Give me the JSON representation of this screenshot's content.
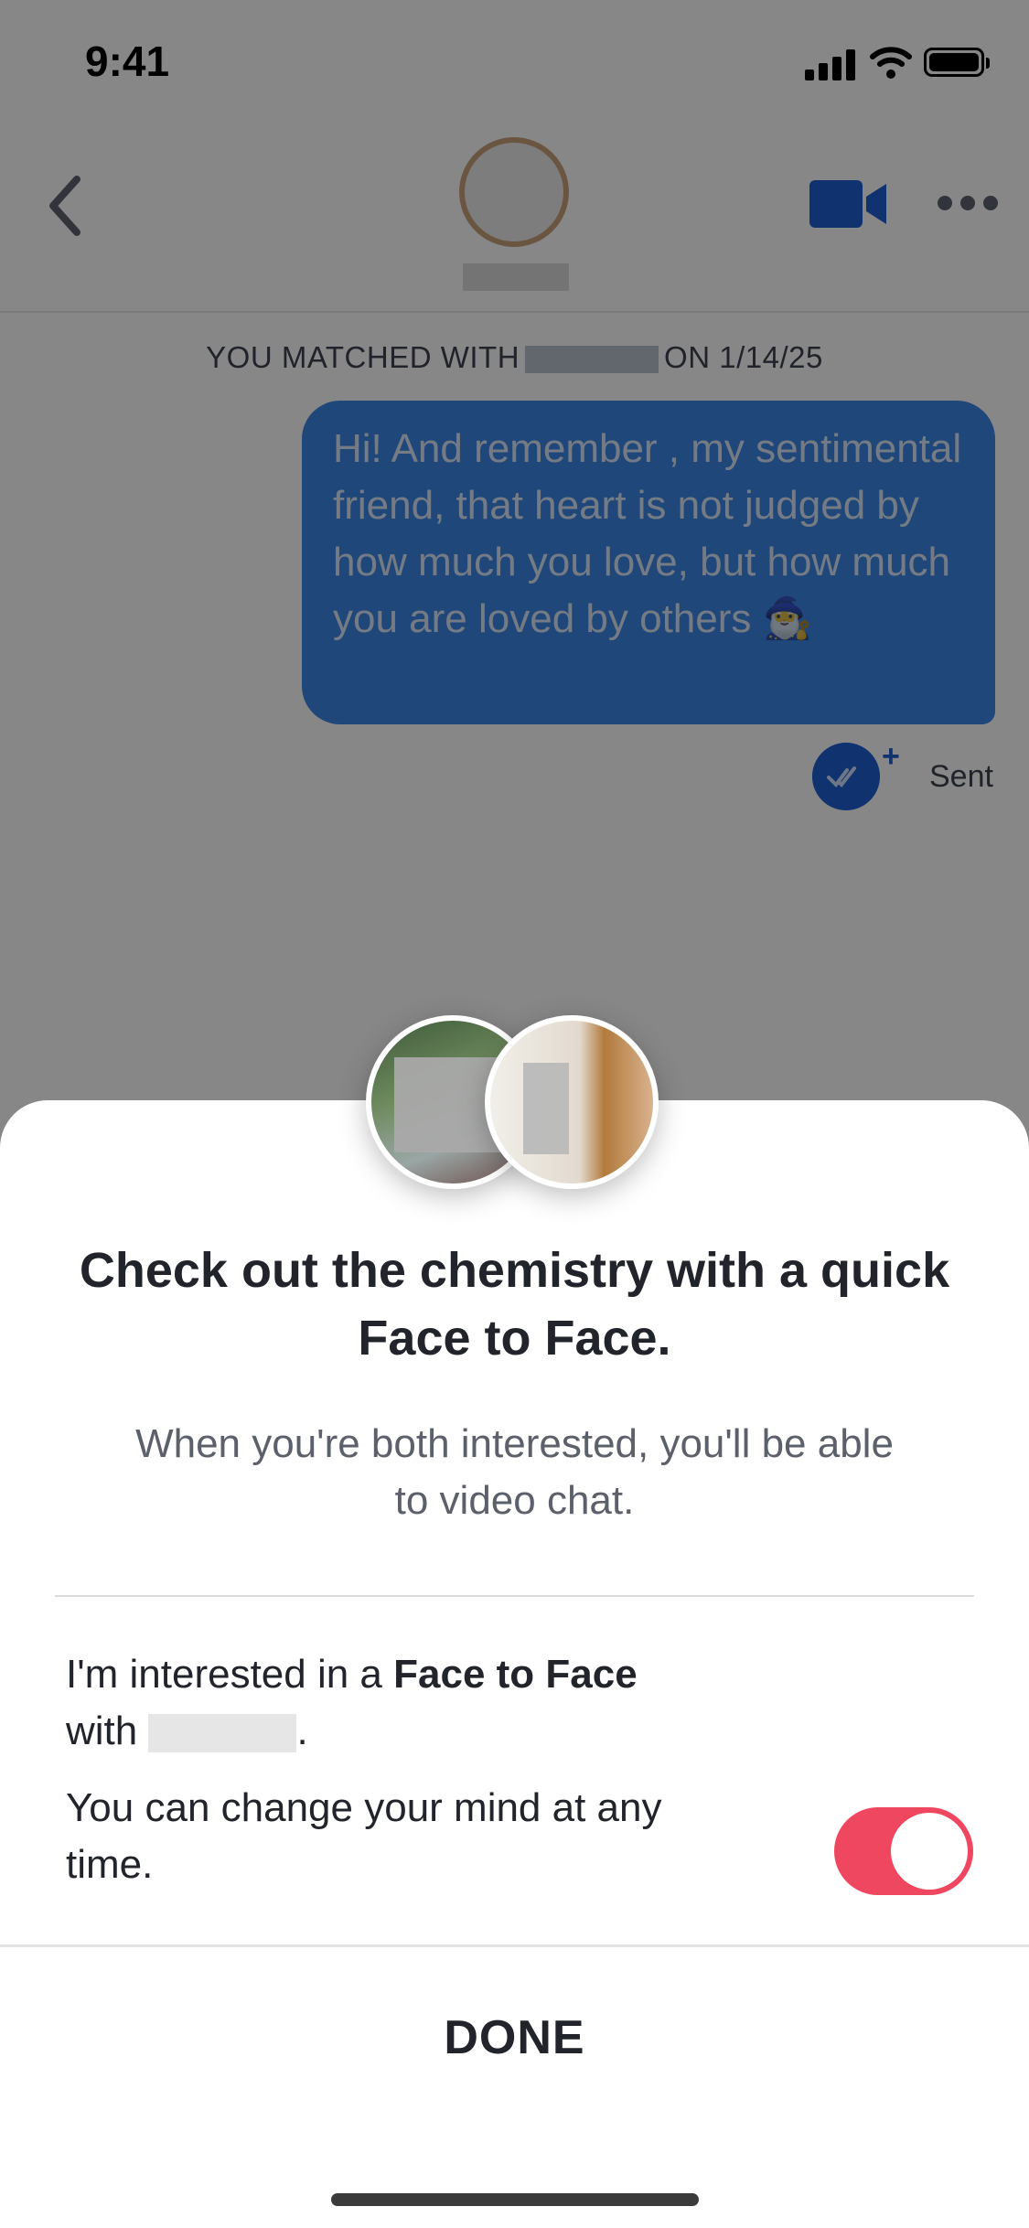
{
  "status_bar": {
    "time": "9:41"
  },
  "chat": {
    "matched_prefix": "YOU MATCHED WITH",
    "matched_suffix": "ON 1/14/25",
    "message": "Hi! And remember , my sentimental friend, that heart is not judged by how much you love, but how much you are loved by others 🧙‍♂️",
    "receipt_status": "Sent",
    "plus": "+"
  },
  "sheet": {
    "title": "Check out the chemistry with a quick Face to Face.",
    "subtitle": "When you're both interested, you'll be able to video chat.",
    "interest_prefix": "I'm interested in a",
    "interest_bold": "Face to Face",
    "interest_with": "with",
    "interest_end": ".",
    "change_note": "You can change your mind at any time.",
    "toggle_on": true,
    "done_label": "DONE"
  },
  "colors": {
    "accent_blue": "#1f5fd0",
    "bubble_blue": "#3d87e6",
    "toggle_red": "#f04760"
  },
  "icons": [
    "back-chevron-icon",
    "video-camera-icon",
    "more-dots-icon",
    "read-receipt-icon",
    "signal-icon",
    "wifi-icon",
    "battery-icon"
  ]
}
